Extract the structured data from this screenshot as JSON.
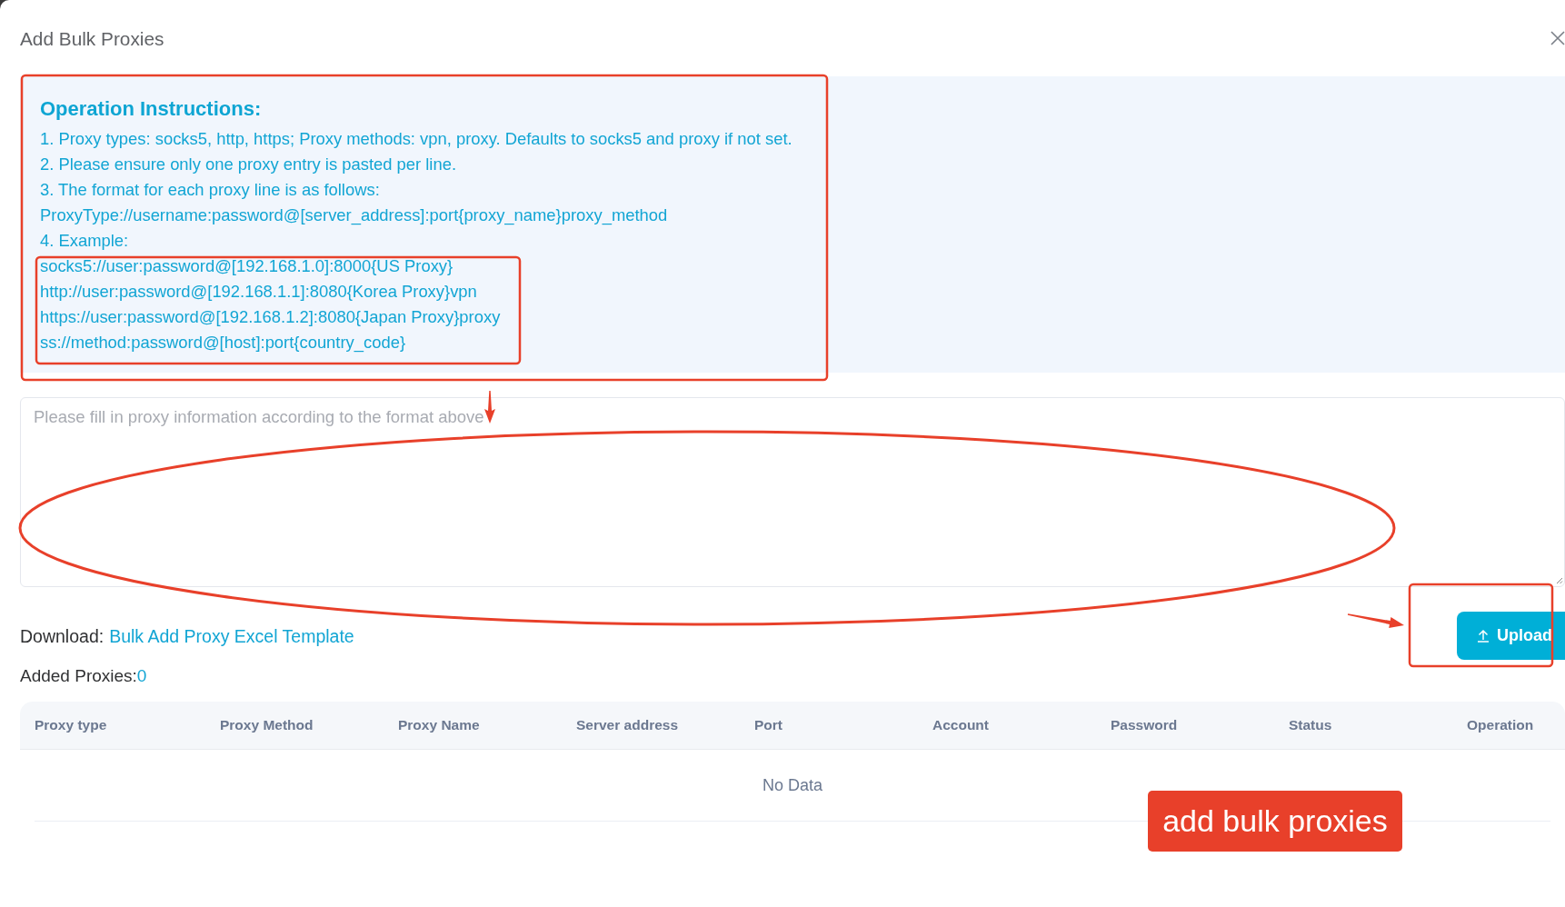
{
  "dialog": {
    "title": "Add Bulk Proxies"
  },
  "instructions": {
    "heading": "Operation Instructions:",
    "lines": [
      "1. Proxy types: socks5, http, https; Proxy methods: vpn, proxy. Defaults to socks5 and proxy if not set.",
      "2. Please ensure only one proxy entry is pasted per line.",
      "3. The format for each proxy line is as follows:",
      "ProxyType://username:password@[server_address]:port{proxy_name}proxy_method",
      "4. Example:"
    ],
    "examples": [
      "socks5://user:password@[192.168.1.0]:8000{US Proxy}",
      "http://user:password@[192.168.1.1]:8080{Korea Proxy}vpn",
      "https://user:password@[192.168.1.2]:8080{Japan Proxy}proxy",
      "ss://method:password@[host]:port{country_code}"
    ]
  },
  "proxy_input": {
    "placeholder": "Please fill in proxy information according to the format above"
  },
  "upload_button": {
    "label": "Upload"
  },
  "download": {
    "label": "Download:",
    "link": "Bulk Add Proxy Excel Template"
  },
  "added_proxies": {
    "label": "Added Proxies:",
    "count": "0"
  },
  "table": {
    "columns": [
      "Proxy type",
      "Proxy Method",
      "Proxy Name",
      "Server address",
      "Port",
      "Account",
      "Password",
      "Status",
      "Operation"
    ],
    "empty_text": "No Data"
  },
  "annotation_label": {
    "text": "add bulk proxies"
  }
}
